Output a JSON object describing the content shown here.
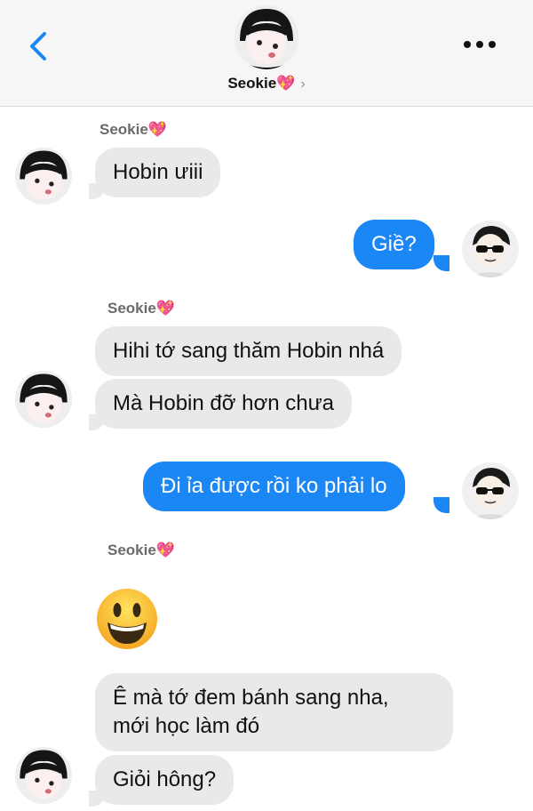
{
  "header": {
    "contact_name": "Seokie💖",
    "chevron": "›",
    "back_icon": "chevron-left-icon",
    "more_icon": "ellipsis-icon"
  },
  "messages": {
    "sender_1": "Seokie💖",
    "m1": "Hobin ưiii",
    "m2": "Giề?",
    "sender_2": "Seokie💖",
    "m3": "Hihi tớ sang thăm Hobin nhá",
    "m4": "Mà Hobin đỡ hơn chưa",
    "m5": "Đi ỉa được rồi ko phải lo",
    "sender_3": "Seokie💖",
    "emoji": "smiley-emoji",
    "m6_line1": "Ê mà tớ đem bánh sang nha,",
    "m6_line2": "mới học làm đó",
    "m7": "Giỏi hông?"
  },
  "colors": {
    "outgoing": "#1b87f5",
    "incoming": "#e9e9eb",
    "accent": "#1b87f5"
  }
}
